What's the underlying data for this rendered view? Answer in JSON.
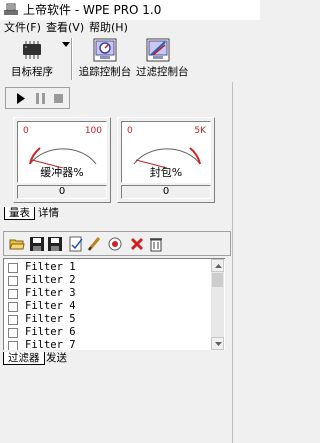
{
  "window": {
    "title": "上帝软件 - WPE PRO 1.0"
  },
  "menu": [
    "文件(F)",
    "查看(V)",
    "帮助(H)"
  ],
  "toolbar": {
    "target_label": "目标程序",
    "trace_label": "追踪控制台",
    "filter_label": "过滤控制台"
  },
  "gauges": [
    {
      "min": "0",
      "max": "100",
      "caption": "缓冲器%",
      "value": "0"
    },
    {
      "min": "0",
      "max": "5K",
      "caption": "封包%",
      "value": "0"
    }
  ],
  "upper_tabs": [
    "量表",
    "详情"
  ],
  "filters": [
    "Filter 1",
    "Filter 2",
    "Filter 3",
    "Filter 4",
    "Filter 5",
    "Filter 6",
    "Filter 7"
  ],
  "lower_tabs": [
    "过滤器",
    "发送"
  ]
}
